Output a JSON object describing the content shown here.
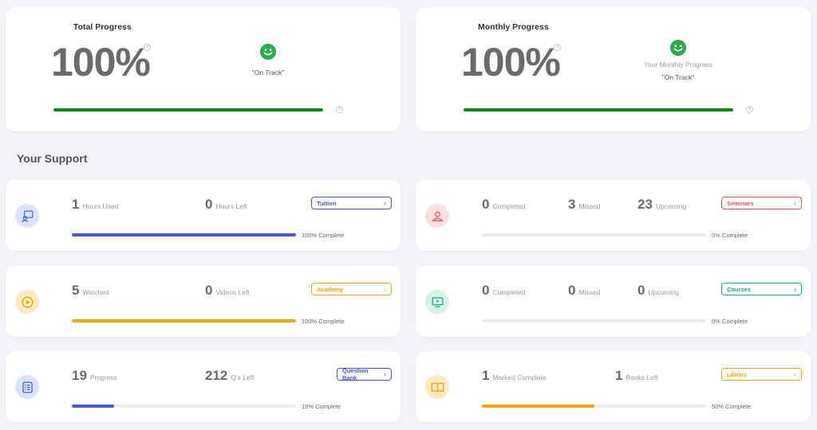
{
  "total": {
    "title": "Total Progress",
    "value": "100%",
    "status": "\"On Track\"",
    "progress": 1.0,
    "bar_color": "#0e8a0e"
  },
  "monthly": {
    "title": "Monthly Progress",
    "value": "100%",
    "subtitle": "Your Monthly Progress",
    "status": "\"On Track\"",
    "progress": 1.0,
    "bar_color": "#0e8a0e"
  },
  "help_glyph": "?",
  "section_title": "Your Support",
  "cards": [
    {
      "icon": "chat-icon",
      "icon_bg": "#dbe4fb",
      "icon_color": "#4a6cd4",
      "metrics": [
        {
          "value": "1",
          "label": "Hours Used"
        },
        {
          "value": "0",
          "label": "Hours Left"
        }
      ],
      "button": "Tuition",
      "accent": "#4a55d8",
      "progress": 1.0,
      "pct_label": "100% Complete"
    },
    {
      "icon": "user-icon",
      "icon_bg": "#fbe0e0",
      "icon_color": "#d9534f",
      "metrics": [
        {
          "value": "0",
          "label": "Completed"
        },
        {
          "value": "3",
          "label": "Missed"
        },
        {
          "value": "23",
          "label": "Upcoming"
        }
      ],
      "button": "Seminars",
      "accent": "#e05555",
      "progress": 0.0,
      "pct_label": "0% Complete"
    },
    {
      "icon": "play-icon",
      "icon_bg": "#fde9c4",
      "icon_color": "#f0a000",
      "metrics": [
        {
          "value": "5",
          "label": "Watched"
        },
        {
          "value": "0",
          "label": "Videos Left"
        }
      ],
      "button": "Academy",
      "accent": "#f5a70a",
      "progress": 1.0,
      "pct_label": "100% Complete"
    },
    {
      "icon": "monitor-play-icon",
      "icon_bg": "#d6f3ea",
      "icon_color": "#1ba884",
      "metrics": [
        {
          "value": "0",
          "label": "Completed"
        },
        {
          "value": "0",
          "label": "Missed"
        },
        {
          "value": "0",
          "label": "Upcoming"
        }
      ],
      "button": "Courses",
      "accent": "#1ba884",
      "progress": 0.0,
      "pct_label": "0% Complete"
    },
    {
      "icon": "list-icon",
      "icon_bg": "#dbe4fb",
      "icon_color": "#3e5fd0",
      "metrics": [
        {
          "value": "19",
          "label": "Progress"
        },
        {
          "value": "212",
          "label": "Q's Left"
        }
      ],
      "button": "Question Bank",
      "accent": "#4a55d8",
      "progress": 0.19,
      "pct_label": "19% Complete"
    },
    {
      "icon": "book-icon",
      "icon_bg": "#fde9c4",
      "icon_color": "#f0a000",
      "metrics": [
        {
          "value": "1",
          "label": "Marked Complete"
        },
        {
          "value": "1",
          "label": "Books Left"
        }
      ],
      "button": "Library",
      "accent": "#f5a70a",
      "progress": 0.5,
      "pct_label": "50% Complete"
    }
  ]
}
